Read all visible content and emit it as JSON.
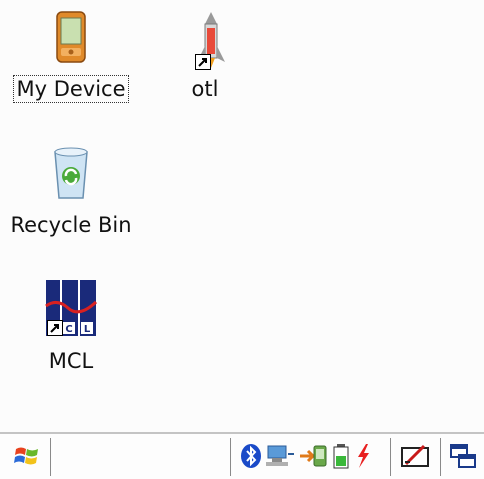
{
  "desktop": {
    "icons": [
      {
        "label": "My Device",
        "icon": "pda-device-icon",
        "selected": true
      },
      {
        "label": "otl",
        "icon": "rocket-shortcut-icon",
        "shortcut": true
      },
      {
        "label": "Recycle Bin",
        "icon": "recycle-bin-icon"
      },
      {
        "label": "MCL",
        "icon": "mcl-shortcut-icon",
        "shortcut": true
      }
    ]
  },
  "taskbar": {
    "start_icon": "windows-flag-icon",
    "tray": [
      "bluetooth-icon",
      "network-icon",
      "sync-icon",
      "battery-icon",
      "power-icon"
    ],
    "input_panel_icon": "input-panel-icon",
    "windows_icon": "window-switcher-icon"
  },
  "colors": {
    "desktop_bg": "#fcfcfc",
    "taskbar_bg": "#fdfdfd",
    "label_text": "#111111"
  }
}
